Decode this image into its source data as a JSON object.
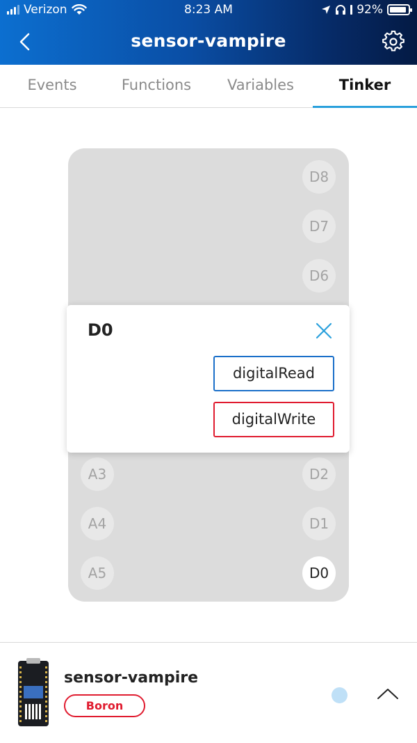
{
  "status_bar": {
    "carrier": "Verizon",
    "time": "8:23 AM",
    "battery": "92%",
    "battery_level": 0.92,
    "icons": [
      "signal-icon",
      "wifi-icon",
      "location-icon",
      "headphones-icon",
      "battery-icon"
    ]
  },
  "header": {
    "title": "sensor-vampire",
    "back_icon": "chevron-left-icon",
    "settings_icon": "gear-icon"
  },
  "tabs": [
    {
      "label": "Events",
      "active": false
    },
    {
      "label": "Functions",
      "active": false
    },
    {
      "label": "Variables",
      "active": false
    },
    {
      "label": "Tinker",
      "active": true
    }
  ],
  "board": {
    "right_pins": [
      "D8",
      "D7",
      "D6",
      "D2",
      "D1",
      "D0"
    ],
    "left_pins": [
      "A3",
      "A4",
      "A5"
    ],
    "active_pin": "D0"
  },
  "popup": {
    "pin_name": "D0",
    "close_icon": "close-icon",
    "read_label": "digitalRead",
    "write_label": "digitalWrite",
    "colors": {
      "read": "#1a6fc9",
      "write": "#e01b2f"
    }
  },
  "device_bar": {
    "name": "sensor-vampire",
    "platform": "Boron",
    "status_color": "#bfe0f7",
    "expand_icon": "chevron-up-icon"
  }
}
